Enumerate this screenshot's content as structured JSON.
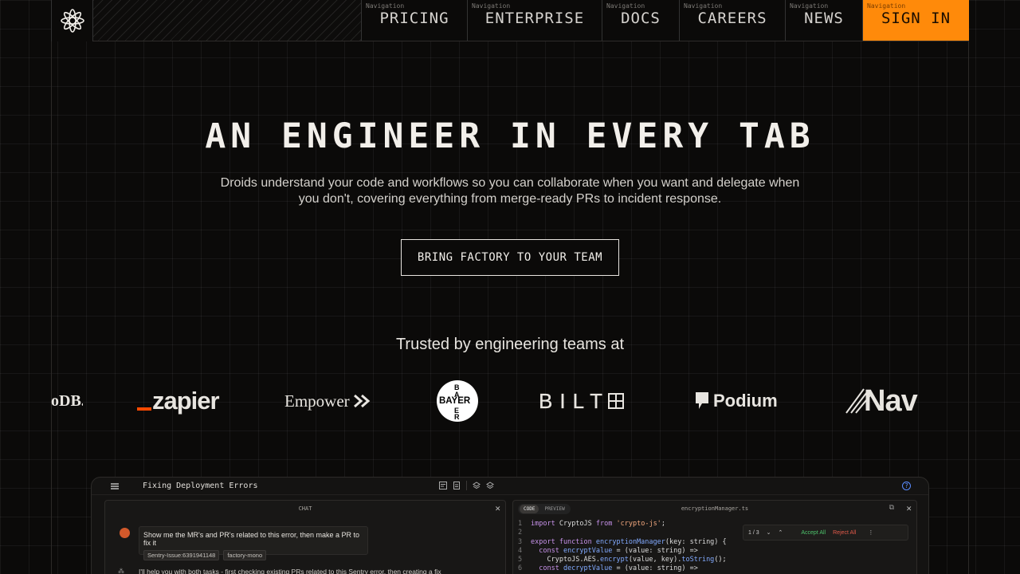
{
  "nav": {
    "caption": "Navigation",
    "items": [
      {
        "label": "PRICING"
      },
      {
        "label": "ENTERPRISE"
      },
      {
        "label": "DOCS"
      },
      {
        "label": "CAREERS"
      },
      {
        "label": "NEWS"
      },
      {
        "label": "SIGN IN"
      }
    ]
  },
  "hero": {
    "title": "AN ENGINEER IN EVERY TAB",
    "subtitle": "Droids understand your code and workflows so you can collaborate when you want and delegate when you don't, covering everything from merge-ready PRs to incident response.",
    "cta": "BRING FACTORY TO YOUR TEAM"
  },
  "trusted": {
    "heading": "Trusted by engineering teams at",
    "logos": {
      "mongodb": "oDB.",
      "zapier": "zapier",
      "empower": "Empower",
      "bayer_h": "BAYER",
      "bayer_v1": "B",
      "bayer_v2": "A",
      "bayer_v3": "E",
      "bayer_v4": "R",
      "bilt": "BILT",
      "podium": "Podium",
      "nav": "Nav"
    }
  },
  "app": {
    "title": "Fixing Deployment Errors",
    "chat": {
      "header": "CHAT",
      "message": "Show me the MR's and PR's related to this error, then make a PR to fix it",
      "chips": [
        "Sentry-Issue:6391941148",
        "factory-mono"
      ],
      "reply": "I'll help you with both tasks - first checking existing PRs related to this Sentry error, then creating a fix"
    },
    "code": {
      "tabs": [
        "CODE",
        "PREVIEW"
      ],
      "filename": "encryptionManager.ts",
      "find_count": "1 / 3",
      "accept": "Accept All",
      "reject": "Reject All",
      "lines": {
        "n1": "1",
        "n2": "2",
        "n3": "3",
        "n4": "4",
        "n5": "5",
        "n6": "6",
        "l1_kw": "import",
        "l1_a": " CryptoJS ",
        "l1_kw2": "from",
        "l1_str": " 'crypto-js'",
        "l1_b": ";",
        "l3_kw": "export function",
        "l3_fn": " encryptionManager",
        "l3_a": "(key: string) {",
        "l4_kw": "  const",
        "l4_fn": " encryptValue",
        "l4_a": " = (value: string) =>",
        "l5_a": "    CryptoJS.AES.",
        "l5_fn": "encrypt",
        "l5_b": "(value, key).",
        "l5_fn2": "toString",
        "l5_c": "();",
        "l6_kw": "  const",
        "l6_fn": " decryptValue",
        "l6_a": " = (value: string) =>"
      }
    }
  }
}
